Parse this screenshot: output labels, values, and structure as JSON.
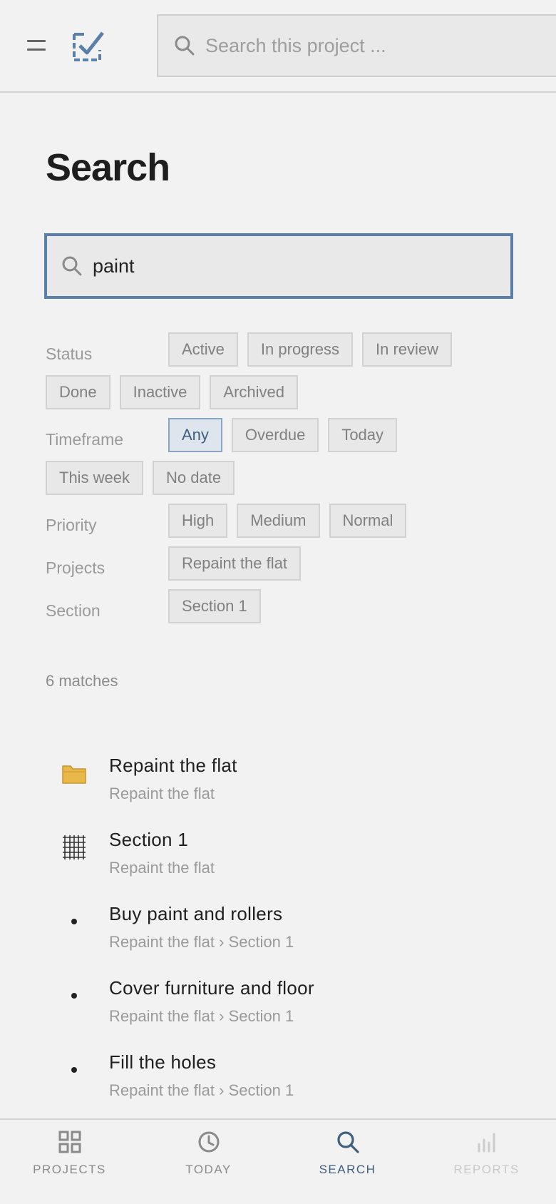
{
  "header": {
    "search_placeholder": "Search this project ..."
  },
  "page": {
    "title": "Search",
    "search_value": "paint"
  },
  "filters": {
    "status": {
      "label": "Status",
      "options": [
        "Active",
        "In progress",
        "In review",
        "Done",
        "Inactive",
        "Archived"
      ]
    },
    "timeframe": {
      "label": "Timeframe",
      "options": [
        "Any",
        "Overdue",
        "Today",
        "This week",
        "No date"
      ],
      "selected": "Any"
    },
    "priority": {
      "label": "Priority",
      "options": [
        "High",
        "Medium",
        "Normal"
      ]
    },
    "projects": {
      "label": "Projects",
      "options": [
        "Repaint the flat"
      ]
    },
    "section": {
      "label": "Section",
      "options": [
        "Section 1"
      ]
    }
  },
  "matches_text": "6 matches",
  "results": [
    {
      "icon": "folder-icon",
      "title": "Repaint the flat",
      "path": "Repaint the flat"
    },
    {
      "icon": "grid-icon",
      "title": "Section 1",
      "path": "Repaint the flat"
    },
    {
      "icon": "bullet-icon",
      "title": "Buy paint and rollers",
      "path": "Repaint the flat › Section 1"
    },
    {
      "icon": "bullet-icon",
      "title": "Cover furniture and floor",
      "path": "Repaint the flat › Section 1"
    },
    {
      "icon": "bullet-icon",
      "title": "Fill the holes",
      "path": "Repaint the flat › Section 1"
    }
  ],
  "nav": {
    "projects": "PROJECTS",
    "today": "TODAY",
    "search": "SEARCH",
    "reports": "REPORTS"
  },
  "colors": {
    "accent": "#3f5f80",
    "focus_border": "#5a7fa8",
    "background": "#f2f2f2"
  }
}
